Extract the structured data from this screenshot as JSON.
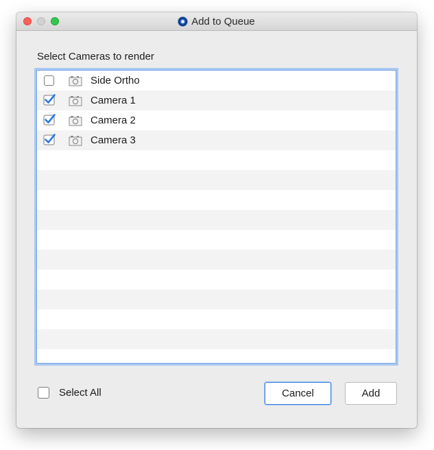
{
  "window": {
    "title": "Add to Queue",
    "app_icon": "renderer-app-icon"
  },
  "prompt": "Select Cameras to render",
  "cameras": [
    {
      "label": "Side Ortho",
      "checked": false,
      "icon": "camera-icon"
    },
    {
      "label": "Camera 1",
      "checked": true,
      "icon": "camera-icon"
    },
    {
      "label": "Camera 2",
      "checked": true,
      "icon": "camera-icon"
    },
    {
      "label": "Camera 3",
      "checked": true,
      "icon": "camera-icon"
    }
  ],
  "footer": {
    "select_all_label": "Select All",
    "select_all_checked": false,
    "cancel_label": "Cancel",
    "add_label": "Add"
  },
  "colors": {
    "accent": "#3f82dd",
    "check": "#2a78e4"
  }
}
